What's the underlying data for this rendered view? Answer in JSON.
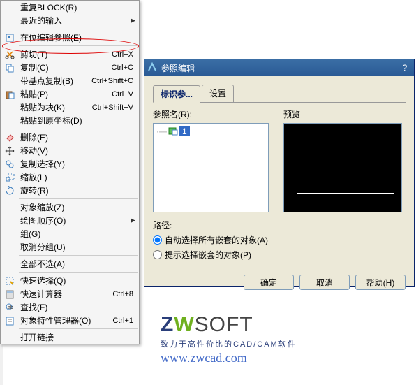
{
  "menu": {
    "items": [
      {
        "label": "重复BLOCK(R)",
        "shortcut": "",
        "icon": ""
      },
      {
        "label": "最近的输入",
        "shortcut": "",
        "icon": "",
        "arrow": true
      },
      {
        "sep": true
      },
      {
        "label": "在位编辑参照(E)",
        "shortcut": "",
        "icon": "edit-ref"
      },
      {
        "sep": true
      },
      {
        "label": "剪切(T)",
        "shortcut": "Ctrl+X",
        "icon": "cut"
      },
      {
        "label": "复制(C)",
        "shortcut": "Ctrl+C",
        "icon": "copy"
      },
      {
        "label": "带基点复制(B)",
        "shortcut": "Ctrl+Shift+C",
        "icon": ""
      },
      {
        "label": "粘贴(P)",
        "shortcut": "Ctrl+V",
        "icon": "paste"
      },
      {
        "label": "粘贴为块(K)",
        "shortcut": "Ctrl+Shift+V",
        "icon": ""
      },
      {
        "label": "粘贴到原坐标(D)",
        "shortcut": "",
        "icon": ""
      },
      {
        "sep": true
      },
      {
        "label": "删除(E)",
        "shortcut": "",
        "icon": "erase"
      },
      {
        "label": "移动(V)",
        "shortcut": "",
        "icon": "move"
      },
      {
        "label": "复制选择(Y)",
        "shortcut": "",
        "icon": "copysel"
      },
      {
        "label": "缩放(L)",
        "shortcut": "",
        "icon": "scale"
      },
      {
        "label": "旋转(R)",
        "shortcut": "",
        "icon": "rotate"
      },
      {
        "sep": true
      },
      {
        "label": "对象缩放(Z)",
        "shortcut": "",
        "icon": ""
      },
      {
        "label": "绘图顺序(O)",
        "shortcut": "",
        "icon": "",
        "arrow": true
      },
      {
        "label": "组(G)",
        "shortcut": "",
        "icon": ""
      },
      {
        "label": "取消分组(U)",
        "shortcut": "",
        "icon": ""
      },
      {
        "sep": true
      },
      {
        "label": "全部不选(A)",
        "shortcut": "",
        "icon": ""
      },
      {
        "sep": true
      },
      {
        "label": "快速选择(Q)",
        "shortcut": "",
        "icon": "qselect"
      },
      {
        "label": "快速计算器",
        "shortcut": "Ctrl+8",
        "icon": "calc"
      },
      {
        "label": "查找(F)",
        "shortcut": "",
        "icon": "find"
      },
      {
        "label": "对象特性管理器(O)",
        "shortcut": "Ctrl+1",
        "icon": "props"
      },
      {
        "sep": true
      },
      {
        "label": "打开链接",
        "shortcut": "",
        "icon": ""
      }
    ]
  },
  "dialog": {
    "title": "参照编辑",
    "tabs": {
      "active": "标识参...",
      "other": "设置"
    },
    "refname_label": "参照名(R):",
    "preview_label": "预览",
    "tree_selected": "1",
    "path_label": "路径:",
    "radio1": "自动选择所有嵌套的对象(A)",
    "radio2": "提示选择嵌套的对象(P)",
    "buttons": {
      "ok": "确定",
      "cancel": "取消",
      "help": "帮助(H)"
    }
  },
  "logo": {
    "tagline": "致力于高性价比的CAD/CAM软件",
    "url": "www.zwcad.com"
  }
}
